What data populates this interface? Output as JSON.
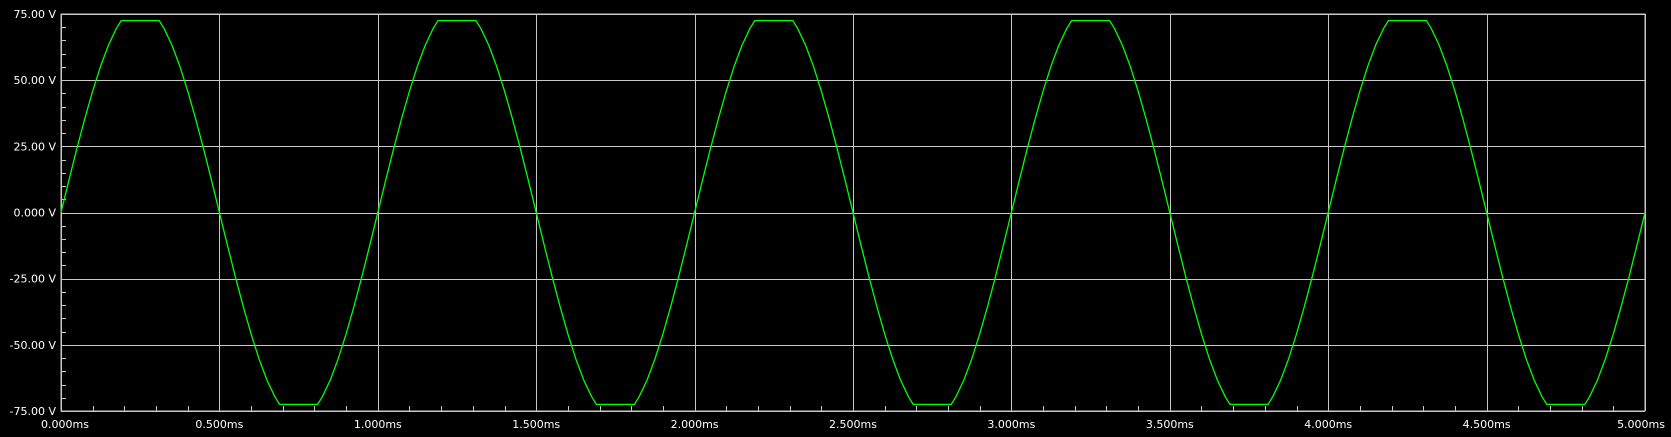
{
  "chart_data": {
    "type": "line",
    "title": "",
    "xlabel": "",
    "ylabel": "",
    "xlim": [
      0,
      5.0
    ],
    "ylim": [
      -75,
      75
    ],
    "x_unit": "ms",
    "y_unit": "V",
    "grid": true,
    "background": "#000000",
    "grid_color": "#c8c8c8",
    "x_ticks": [
      0,
      0.5,
      1.0,
      1.5,
      2.0,
      2.5,
      3.0,
      3.5,
      4.0,
      4.5,
      5.0
    ],
    "x_tick_labels": [
      "0.000ms",
      "0.500ms",
      "1.000ms",
      "1.500ms",
      "2.000ms",
      "2.500ms",
      "3.000ms",
      "3.500ms",
      "4.000ms",
      "4.500ms",
      "5.000ms"
    ],
    "y_ticks": [
      75,
      50,
      25,
      0,
      -25,
      -50,
      -75
    ],
    "y_tick_labels": [
      "75.00 V",
      "50.00 V",
      "25.00 V",
      "0.000 V",
      "-25.00 V",
      "-50.00 V",
      "-75.00 V"
    ],
    "series": [
      {
        "color": "#00ff00",
        "x": [
          0,
          0.025,
          0.05,
          0.075,
          0.1,
          0.125,
          0.15,
          0.175,
          0.19,
          0.31,
          0.325,
          0.35,
          0.375,
          0.4,
          0.425,
          0.45,
          0.475,
          0.5,
          0.525,
          0.55,
          0.575,
          0.6,
          0.625,
          0.65,
          0.675,
          0.69,
          0.81,
          0.825,
          0.85,
          0.875,
          0.9,
          0.925,
          0.95,
          0.975,
          1.0,
          1.025,
          1.05,
          1.075,
          1.1,
          1.125,
          1.15,
          1.175,
          1.19,
          1.31,
          1.325,
          1.35,
          1.375,
          1.4,
          1.425,
          1.45,
          1.475,
          1.5,
          1.525,
          1.55,
          1.575,
          1.6,
          1.625,
          1.65,
          1.675,
          1.69,
          1.81,
          1.825,
          1.85,
          1.875,
          1.9,
          1.925,
          1.95,
          1.975,
          2.0,
          2.025,
          2.05,
          2.075,
          2.1,
          2.125,
          2.15,
          2.175,
          2.19,
          2.31,
          2.325,
          2.35,
          2.375,
          2.4,
          2.425,
          2.45,
          2.475,
          2.5,
          2.525,
          2.55,
          2.575,
          2.6,
          2.625,
          2.65,
          2.675,
          2.69,
          2.81,
          2.825,
          2.85,
          2.875,
          2.9,
          2.925,
          2.95,
          2.975,
          3.0,
          3.025,
          3.05,
          3.075,
          3.1,
          3.125,
          3.15,
          3.175,
          3.19,
          3.31,
          3.325,
          3.35,
          3.375,
          3.4,
          3.425,
          3.45,
          3.475,
          3.5,
          3.525,
          3.55,
          3.575,
          3.6,
          3.625,
          3.65,
          3.675,
          3.69,
          3.81,
          3.825,
          3.85,
          3.875,
          3.9,
          3.925,
          3.95,
          3.975,
          4.0,
          4.025,
          4.05,
          4.075,
          4.1,
          4.125,
          4.15,
          4.175,
          4.19,
          4.31,
          4.325,
          4.35,
          4.375,
          4.4,
          4.425,
          4.45,
          4.475,
          4.5,
          4.525,
          4.55,
          4.575,
          4.6,
          4.625,
          4.65,
          4.675,
          4.69,
          4.81,
          4.825,
          4.85,
          4.875,
          4.9,
          4.925,
          4.95,
          4.975,
          5.0
        ],
        "y": [
          0,
          12.2,
          24.1,
          35.4,
          45.9,
          55.3,
          63.3,
          69.6,
          72.5,
          72.5,
          69.6,
          63.3,
          55.3,
          45.9,
          35.4,
          24.1,
          12.2,
          0,
          -12.2,
          -24.1,
          -35.4,
          -45.9,
          -55.3,
          -63.3,
          -69.6,
          -72.5,
          -72.5,
          -69.6,
          -63.3,
          -55.3,
          -45.9,
          -35.4,
          -24.1,
          -12.2,
          0,
          12.2,
          24.1,
          35.4,
          45.9,
          55.3,
          63.3,
          69.6,
          72.5,
          72.5,
          69.6,
          63.3,
          55.3,
          45.9,
          35.4,
          24.1,
          12.2,
          0,
          -12.2,
          -24.1,
          -35.4,
          -45.9,
          -55.3,
          -63.3,
          -69.6,
          -72.5,
          -72.5,
          -69.6,
          -63.3,
          -55.3,
          -45.9,
          -35.4,
          -24.1,
          -12.2,
          0,
          12.2,
          24.1,
          35.4,
          45.9,
          55.3,
          63.3,
          69.6,
          72.5,
          72.5,
          69.6,
          63.3,
          55.3,
          45.9,
          35.4,
          24.1,
          12.2,
          0,
          -12.2,
          -24.1,
          -35.4,
          -45.9,
          -55.3,
          -63.3,
          -69.6,
          -72.5,
          -72.5,
          -69.6,
          -63.3,
          -55.3,
          -45.9,
          -35.4,
          -24.1,
          -12.2,
          0,
          12.2,
          24.1,
          35.4,
          45.9,
          55.3,
          63.3,
          69.6,
          72.5,
          72.5,
          69.6,
          63.3,
          55.3,
          45.9,
          35.4,
          24.1,
          12.2,
          0,
          -12.2,
          -24.1,
          -35.4,
          -45.9,
          -55.3,
          -63.3,
          -69.6,
          -72.5,
          -72.5,
          -69.6,
          -63.3,
          -55.3,
          -45.9,
          -35.4,
          -24.1,
          -12.2,
          0,
          12.2,
          24.1,
          35.4,
          45.9,
          55.3,
          63.3,
          69.6,
          72.5,
          72.5,
          69.6,
          63.3,
          55.3,
          45.9,
          35.4,
          24.1,
          12.2,
          0,
          -12.2,
          -24.1,
          -35.4,
          -45.9,
          -55.3,
          -63.3,
          -69.6,
          -72.5,
          -72.5,
          -69.6,
          -63.3,
          -55.3,
          -45.9,
          -35.4,
          -24.1,
          -12.2,
          0
        ]
      }
    ]
  }
}
